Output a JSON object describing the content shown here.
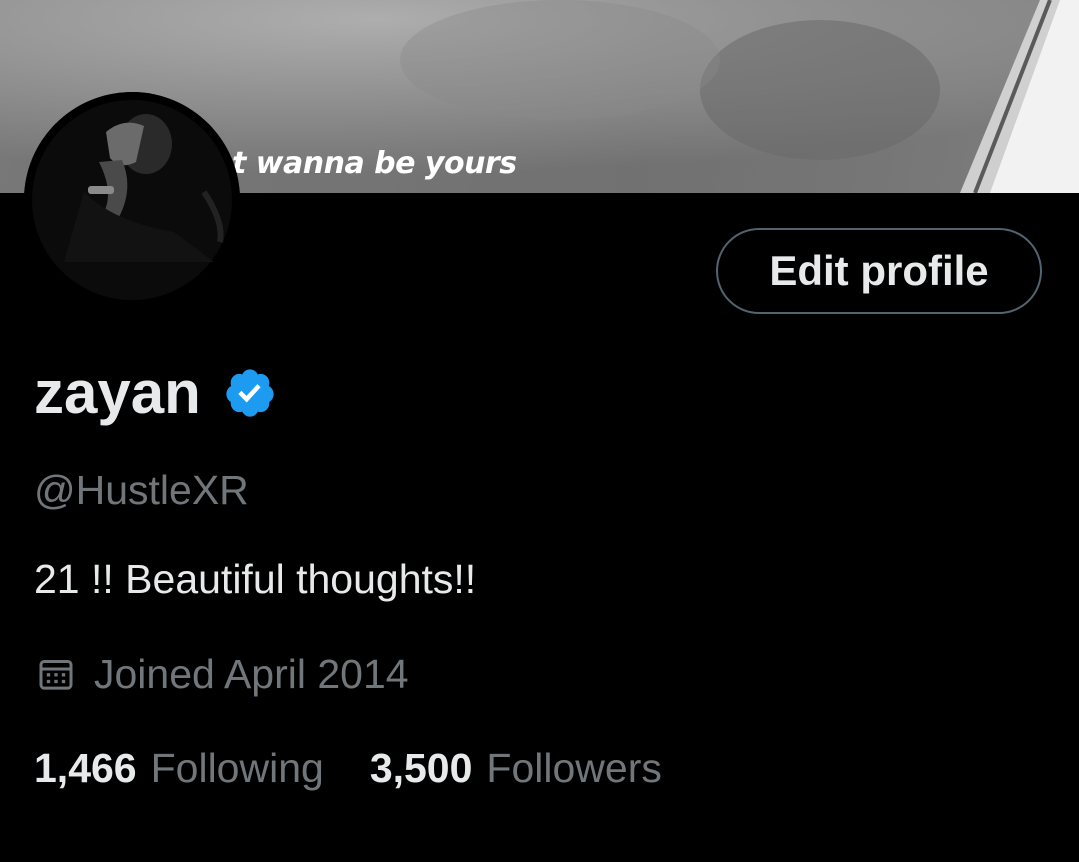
{
  "banner": {
    "caption": "t wanna be yours"
  },
  "profile": {
    "display_name": "zayan",
    "verified": true,
    "handle": "@HustleXR",
    "bio": "21 !! Beautiful thoughts!!",
    "joined": "Joined April 2014"
  },
  "actions": {
    "edit_profile_label": "Edit profile"
  },
  "stats": {
    "following_count": "1,466",
    "following_label": "Following",
    "followers_count": "3,500",
    "followers_label": "Followers"
  },
  "colors": {
    "background": "#000000",
    "primary_text": "#e7e9ea",
    "secondary_text": "#71767b",
    "verified_blue": "#1d9bf0",
    "button_border": "#536471"
  },
  "icons": {
    "verified": "verified-badge-icon",
    "calendar": "calendar-icon"
  }
}
